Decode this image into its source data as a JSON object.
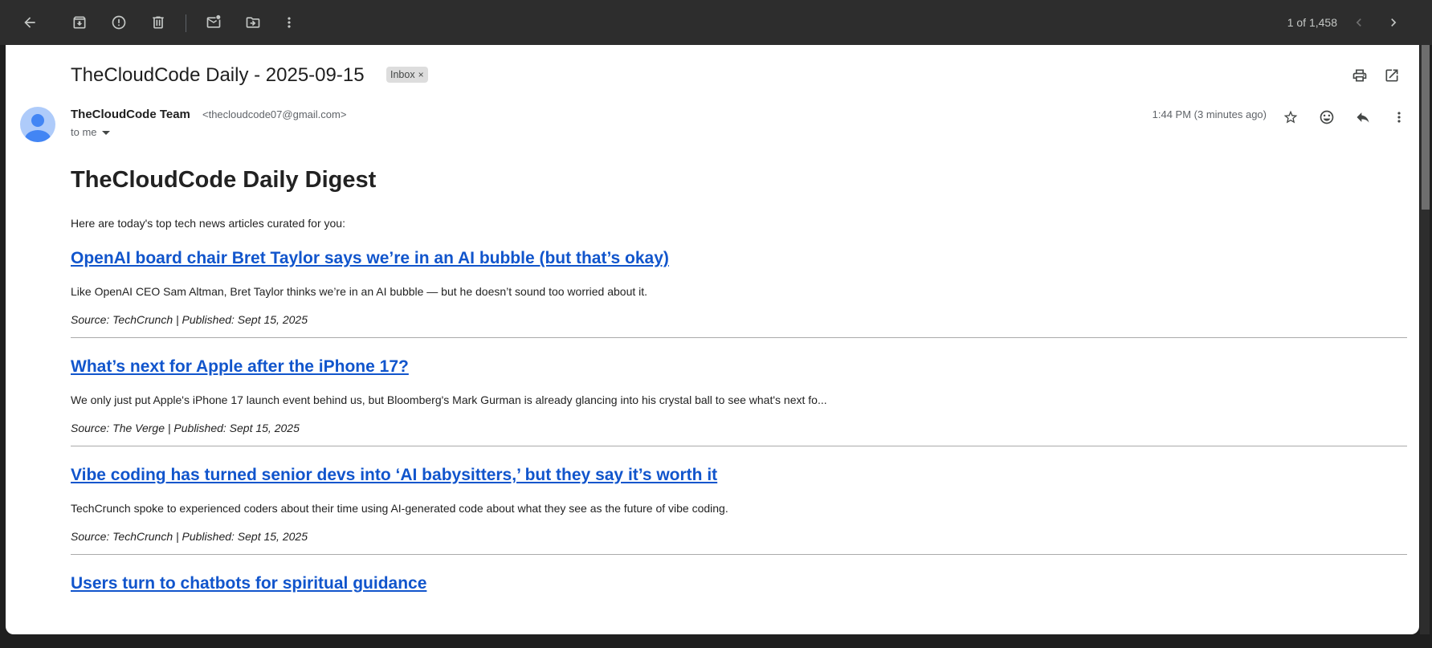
{
  "toolbar": {
    "icons": [
      "back-arrow-icon",
      "archive-icon",
      "report-spam-icon",
      "delete-icon",
      "mark-unread-icon",
      "move-to-icon",
      "more-vert-icon"
    ],
    "pager": "1 of 1,458"
  },
  "email": {
    "subject": "TheCloudCode Daily - 2025-09-15",
    "label": "Inbox",
    "label_remove": "×",
    "sender_name": "TheCloudCode Team",
    "sender_email": "<thecloudcode07@gmail.com>",
    "to": "to me",
    "time": "1:44 PM (3 minutes ago)"
  },
  "body": {
    "heading": "TheCloudCode Daily Digest",
    "intro": "Here are today's top tech news articles curated for you:",
    "articles": [
      {
        "title": "OpenAI board chair Bret Taylor says we’re in an AI bubble (but that’s okay)",
        "desc": "Like OpenAI CEO Sam Altman, Bret Taylor thinks we’re in an AI bubble — but he doesn’t sound too worried about it.",
        "source": "Source: TechCrunch | Published: Sept 15, 2025"
      },
      {
        "title": "What’s next for Apple after the iPhone 17?",
        "desc": "We only just put Apple's iPhone 17 launch event behind us, but Bloomberg's Mark Gurman is already glancing into his crystal ball to see what's next fo...",
        "source": "Source: The Verge | Published: Sept 15, 2025"
      },
      {
        "title": "Vibe coding has turned senior devs into ‘AI babysitters,’ but they say it’s worth it",
        "desc": "TechCrunch spoke to experienced coders about their time using AI-generated code about what they see as the future of vibe coding.",
        "source": "Source: TechCrunch | Published: Sept 15, 2025"
      },
      {
        "title": "Users turn to chatbots for spiritual guidance"
      }
    ]
  }
}
